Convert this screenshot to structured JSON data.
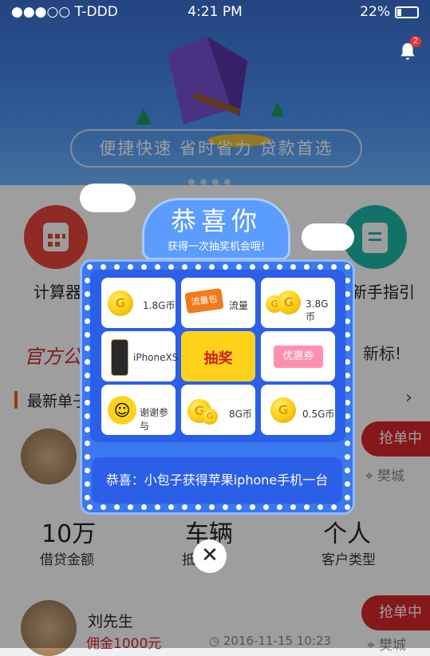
{
  "status_bar": {
    "carrier": "●●●○○ T-DDD",
    "time": "4:21 PM",
    "battery": "22%"
  },
  "banner": {
    "slogan": "便捷快速  省时省力  贷款首选",
    "badge_count": "2"
  },
  "quick_entries": [
    {
      "label": "计算器",
      "color": "#e8453c"
    },
    {
      "label": "新手指引",
      "color": "#1fb8a7"
    }
  ],
  "announce": {
    "left": "官方公",
    "right": "新标!"
  },
  "section": {
    "title": "最新单子"
  },
  "orders": [
    {
      "name": "",
      "btn": "抢单中",
      "city": "樊城"
    },
    {
      "name": "刘先生",
      "btn": "抢单中",
      "amount": "佣金1000元",
      "date": "2016-11-15 10:23",
      "city": "樊城"
    }
  ],
  "stats": [
    {
      "value": "10万",
      "label": "借贷金额"
    },
    {
      "value": "车辆",
      "label": "抵押物"
    },
    {
      "value": "个人",
      "label": "客户类型"
    }
  ],
  "modal": {
    "title": "恭喜你",
    "subtitle": "获得一次抽奖机会哦!",
    "prizes": [
      {
        "label": "1.8G币",
        "icon": "gold-coin-icon"
      },
      {
        "label": "流量",
        "icon": "data-gift-icon",
        "tag": "流量包"
      },
      {
        "label": "3.8G币",
        "icon": "gold-coins-icon"
      },
      {
        "label": "iPhoneXS",
        "icon": "iphone-icon"
      },
      {
        "label": "抽奖",
        "icon": "draw-button"
      },
      {
        "label": "优惠券",
        "icon": "coupon-icon"
      },
      {
        "label": "谢谢参与",
        "icon": "smiley-icon"
      },
      {
        "label": "8G币",
        "icon": "gold-coins-icon"
      },
      {
        "label": "0.5G币",
        "icon": "gold-coin-icon"
      }
    ],
    "message": "恭喜：小包子获得苹果iphone手机一台",
    "close": "✕"
  }
}
